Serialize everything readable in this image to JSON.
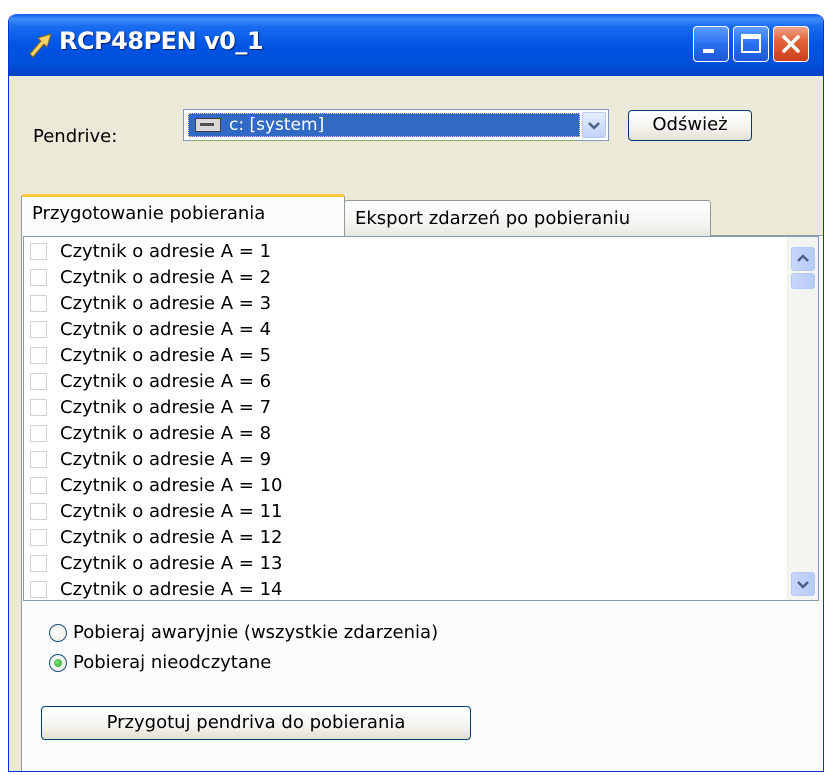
{
  "window": {
    "title": "RCP48PEN v0_1"
  },
  "pendrive": {
    "label": "Pendrive:",
    "selected": "c: [system]",
    "refresh_label": "Odśwież"
  },
  "tabs": [
    {
      "label": "Przygotowanie pobierania",
      "active": true
    },
    {
      "label": "Eksport zdarzeń po pobieraniu",
      "active": false
    }
  ],
  "readers": [
    {
      "label": "Czytnik o adresie A = 1",
      "checked": false
    },
    {
      "label": "Czytnik o adresie A = 2",
      "checked": false
    },
    {
      "label": "Czytnik o adresie A = 3",
      "checked": false
    },
    {
      "label": "Czytnik o adresie A = 4",
      "checked": false
    },
    {
      "label": "Czytnik o adresie A = 5",
      "checked": false
    },
    {
      "label": "Czytnik o adresie A = 6",
      "checked": false
    },
    {
      "label": "Czytnik o adresie A = 7",
      "checked": false
    },
    {
      "label": "Czytnik o adresie A = 8",
      "checked": false
    },
    {
      "label": "Czytnik o adresie A = 9",
      "checked": false
    },
    {
      "label": "Czytnik o adresie A = 10",
      "checked": false
    },
    {
      "label": "Czytnik o adresie A = 11",
      "checked": false
    },
    {
      "label": "Czytnik o adresie A = 12",
      "checked": false
    },
    {
      "label": "Czytnik o adresie A = 13",
      "checked": false
    },
    {
      "label": "Czytnik o adresie A = 14",
      "checked": false
    }
  ],
  "mode": {
    "options": [
      {
        "label": "Pobieraj awaryjnie (wszystkie zdarzenia)",
        "selected": false
      },
      {
        "label": "Pobieraj nieodczytane",
        "selected": true
      }
    ]
  },
  "actions": {
    "prepare_label": "Przygotuj pendriva do pobierania"
  },
  "colors": {
    "titlebar": "#0054e3",
    "selection": "#316ac5",
    "window_bg": "#ece9d8",
    "tab_highlight": "#ffc83c"
  },
  "icons": {
    "app": "arrow-icon",
    "minimize": "minimize-icon",
    "maximize": "maximize-icon",
    "close": "close-icon",
    "drive": "drive-icon",
    "dropdown": "chevron-down-icon"
  }
}
